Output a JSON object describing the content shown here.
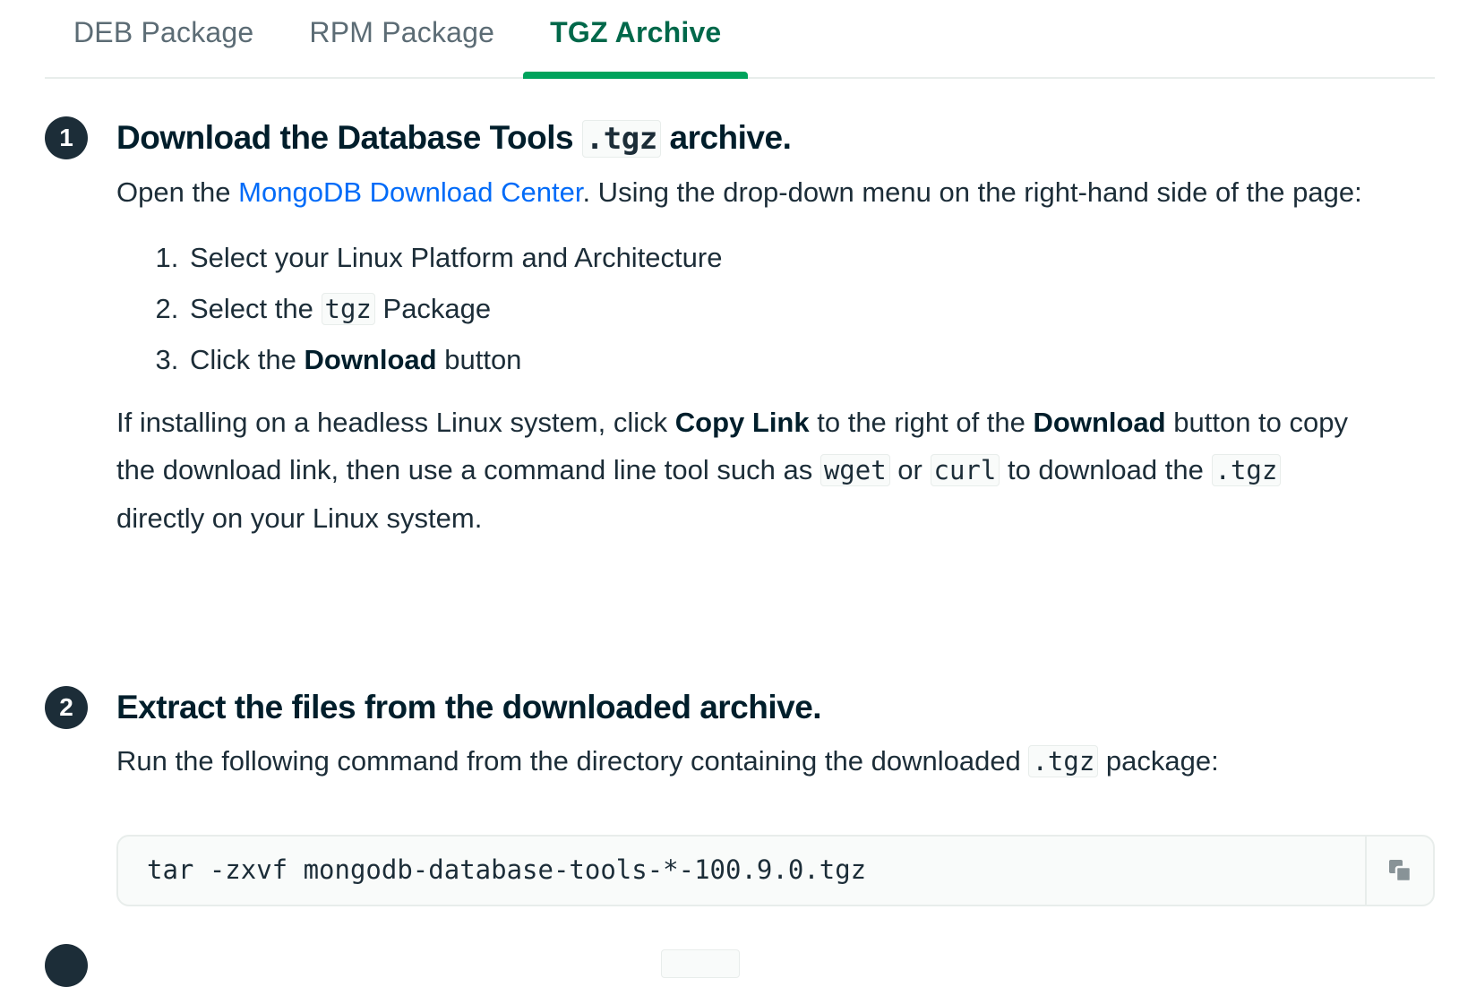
{
  "tabs": [
    {
      "label": "DEB Package",
      "active": false
    },
    {
      "label": "RPM Package",
      "active": false
    },
    {
      "label": "TGZ Archive",
      "active": true
    }
  ],
  "step1": {
    "number": "1",
    "title_before": "Download the Database Tools",
    "title_code": ".tgz",
    "title_after": "archive.",
    "intro_before": "Open the",
    "intro_link": "MongoDB Download Center",
    "intro_after": ". Using the drop-down menu on the right-hand side of the page:",
    "list": {
      "item1": "Select your Linux Platform and Architecture",
      "item2_before": "Select the",
      "item2_code": "tgz",
      "item2_after": "Package",
      "item3_before": "Click the",
      "item3_bold": "Download",
      "item3_after": "button"
    },
    "note": {
      "p1": "If installing on a headless Linux system, click",
      "b1": "Copy Link",
      "p2": "to the right of the",
      "b2": "Download",
      "p3": "button to copy the download link, then use a command line tool such as",
      "c1": "wget",
      "p4": "or",
      "c2": "curl",
      "p5": "to download the",
      "c3": ".tgz",
      "p6": "directly on your Linux system."
    }
  },
  "step2": {
    "number": "2",
    "title": "Extract the files from the downloaded archive.",
    "text_before": "Run the following command from the directory containing the downloaded",
    "text_code": ".tgz",
    "text_after": "package:",
    "command": "tar -zxvf mongodb-database-tools-*-100.9.0.tgz",
    "copy_icon": "copy-icon"
  }
}
